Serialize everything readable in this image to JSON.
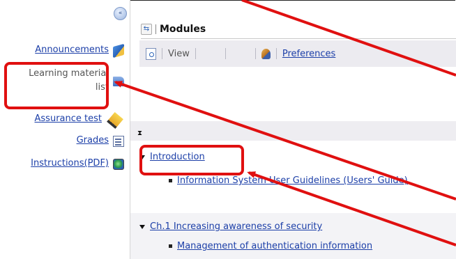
{
  "sidebar": {
    "collapse_glyph": "«",
    "items": [
      {
        "label": "Announcements",
        "icon": "megaphone-icon",
        "link": true
      },
      {
        "label": "Learning material list",
        "icon": "document-icon",
        "link": false
      },
      {
        "label": "Assurance test",
        "icon": "pencil-icon",
        "link": true
      },
      {
        "label": "Grades",
        "icon": "grades-icon",
        "link": true
      },
      {
        "label": "Instructions(PDF)",
        "icon": "pdf-globe-icon",
        "link": true
      }
    ]
  },
  "main": {
    "title_icon_glyph": "⇆",
    "title": "Modules",
    "toolbar": {
      "view_label": "View",
      "preferences_label": "Preferences"
    },
    "hourglass_glyph": "⧗",
    "sections": [
      {
        "title": "Introduction",
        "items": [
          "Information System User Guidelines (Users' Guide)"
        ]
      },
      {
        "title": "Ch.1 Increasing awareness of security",
        "items": [
          "Management of authentication information"
        ]
      }
    ]
  },
  "colors": {
    "link": "#1c3fa8",
    "highlight": "#e01010",
    "toolbar_bg": "#ecebf0"
  }
}
